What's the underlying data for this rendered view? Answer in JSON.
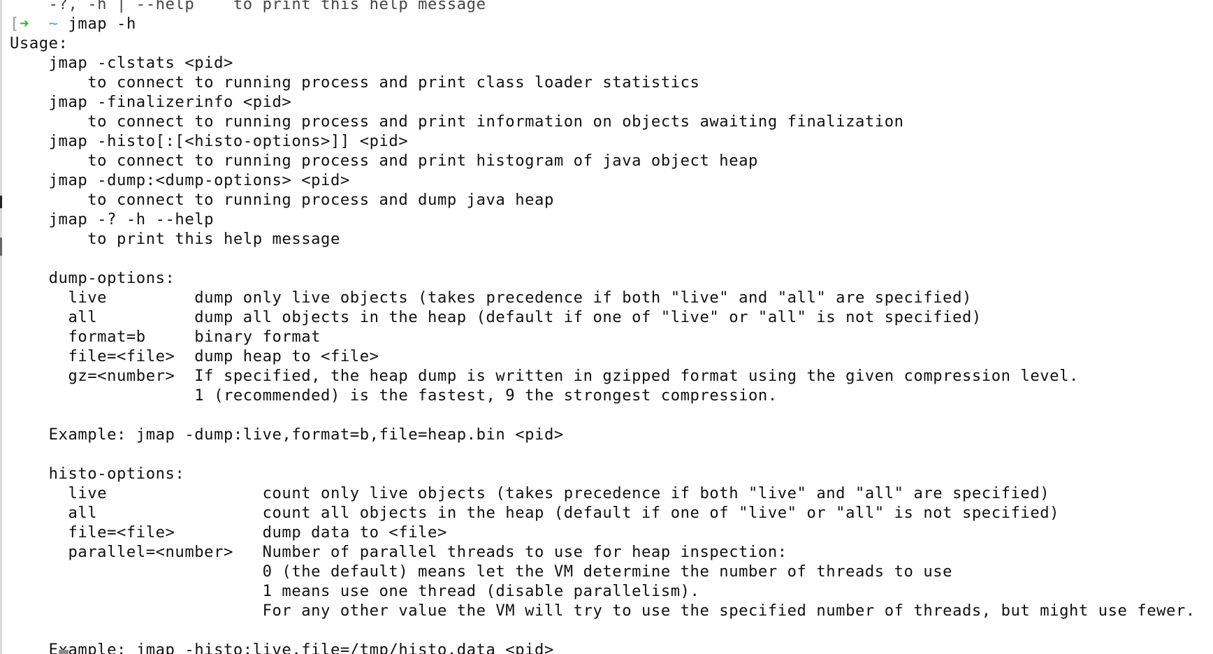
{
  "terminal": {
    "scrolled_line": "    -?, -h | --help    to print this help message",
    "prompt": {
      "bracket": "[",
      "arrow": "➜",
      "tilde": "~",
      "command": "jmap -h"
    },
    "lines": [
      "Usage:",
      "    jmap -clstats <pid>",
      "        to connect to running process and print class loader statistics",
      "    jmap -finalizerinfo <pid>",
      "        to connect to running process and print information on objects awaiting finalization",
      "    jmap -histo[:[<histo-options>]] <pid>",
      "        to connect to running process and print histogram of java object heap",
      "    jmap -dump:<dump-options> <pid>",
      "        to connect to running process and dump java heap",
      "    jmap -? -h --help",
      "        to print this help message",
      "",
      "    dump-options:",
      "      live         dump only live objects (takes precedence if both \"live\" and \"all\" are specified)",
      "      all          dump all objects in the heap (default if one of \"live\" or \"all\" is not specified)",
      "      format=b     binary format",
      "      file=<file>  dump heap to <file>",
      "      gz=<number>  If specified, the heap dump is written in gzipped format using the given compression level.",
      "                   1 (recommended) is the fastest, 9 the strongest compression.",
      "",
      "    Example: jmap -dump:live,format=b,file=heap.bin <pid>",
      "",
      "    histo-options:",
      "      live                count only live objects (takes precedence if both \"live\" and \"all\" are specified)",
      "      all                 count all objects in the heap (default if one of \"live\" or \"all\" is not specified)",
      "      file=<file>         dump data to <file>",
      "      parallel=<number>   Number of parallel threads to use for heap inspection:",
      "                          0 (the default) means let the VM determine the number of threads to use",
      "                          1 means use one thread (disable parallelism).",
      "                          For any other value the VM will try to use the specified number of threads, but might use fewer.",
      "",
      "    Example: jmap -histo:live,file=/tmp/histo.data <pid>"
    ]
  }
}
